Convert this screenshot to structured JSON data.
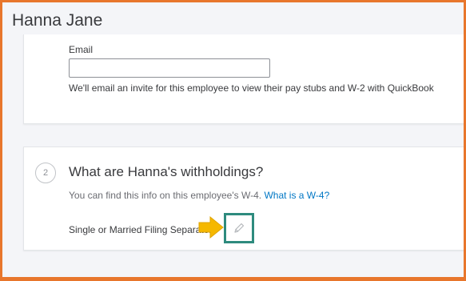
{
  "page": {
    "title": "Hanna Jane"
  },
  "email_section": {
    "label": "Email",
    "value": "",
    "placeholder": "",
    "helper": "We'll email an invite for this employee to view their pay stubs and W-2 with QuickBook"
  },
  "withholdings_section": {
    "step_number": "2",
    "title": "What are Hanna's withholdings?",
    "subtitle_text": "You can find this info on this employee's W-4.",
    "subtitle_link": "What is a W-4?",
    "filing_status": "Single or Married Filing Separately"
  },
  "icons": {
    "edit": "pencil-icon",
    "callout": "arrow-right-icon"
  },
  "colors": {
    "frame_border": "#e8762c",
    "link": "#0077c5",
    "highlight_box": "#2e8b7e",
    "callout_arrow": "#f5b800"
  }
}
